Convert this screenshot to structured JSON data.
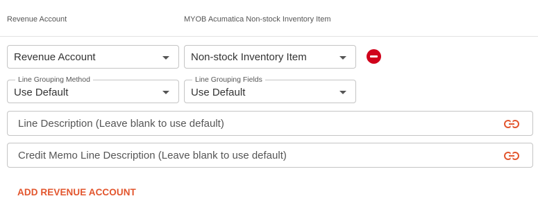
{
  "header": {
    "revenue_account_col": "Revenue Account",
    "item_col": "MYOB Acumatica Non-stock Inventory Item"
  },
  "row": {
    "revenue_account_select": {
      "value": "Revenue Account"
    },
    "item_select": {
      "value": "Non-stock Inventory Item"
    },
    "line_grouping_method": {
      "label": "Line Grouping Method",
      "value": "Use Default"
    },
    "line_grouping_fields": {
      "label": "Line Grouping Fields",
      "value": "Use Default"
    },
    "line_description": {
      "placeholder": "Line Description (Leave blank to use default)"
    },
    "credit_memo_line_description": {
      "placeholder": "Credit Memo Line Description (Leave blank to use default)"
    }
  },
  "actions": {
    "add_revenue_account": "ADD REVENUE ACCOUNT"
  },
  "icons": {
    "remove": "minus-circle-icon",
    "link": "link-icon",
    "caret": "caret-down-icon"
  },
  "colors": {
    "accent": "#e2552d",
    "remove": "#d0021b",
    "border": "#c4c4c4"
  }
}
